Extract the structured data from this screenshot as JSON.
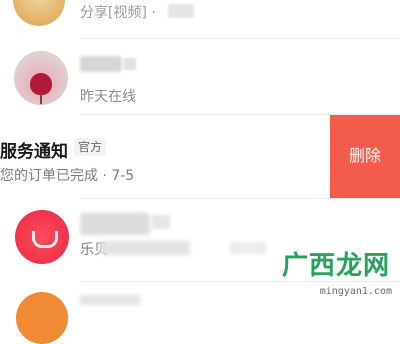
{
  "rows": [
    {
      "subtitle": "分享[视频] · "
    },
    {
      "subtitle": "昨天在线"
    },
    {
      "title": "服务通知",
      "badge": "官方",
      "subtitle": "您的订单已完成 · 7-5",
      "delete_label": "删除"
    },
    {
      "subtitle": "乐贝"
    },
    {}
  ],
  "watermark": {
    "text": "广西龙网",
    "url": "mingyan1.com"
  },
  "colors": {
    "delete_bg": "#f35b4b",
    "watermark": "#26a35a"
  }
}
